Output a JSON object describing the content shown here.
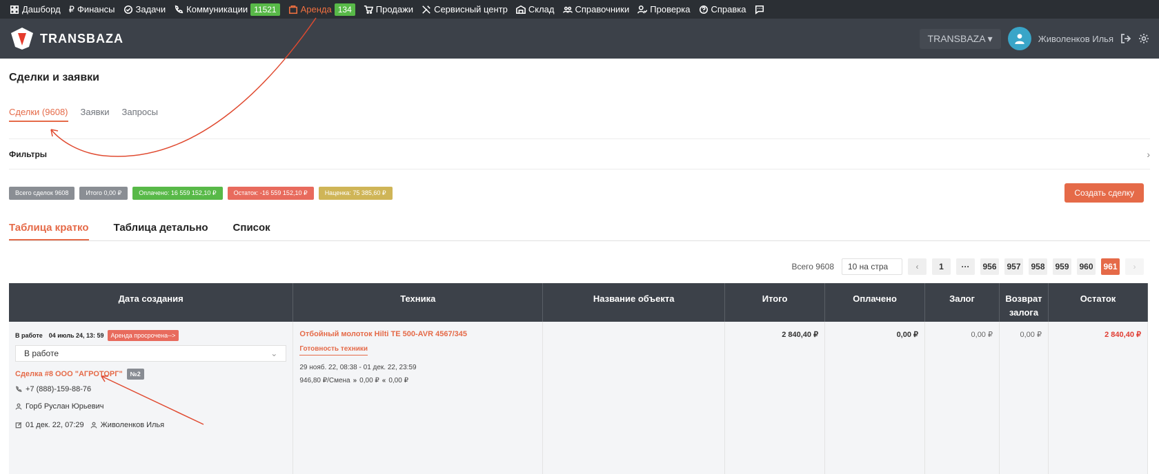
{
  "topnav": {
    "items": [
      {
        "label": "Дашборд",
        "icon": "dashboard-icon"
      },
      {
        "label": "Финансы",
        "icon": "ruble-icon"
      },
      {
        "label": "Задачи",
        "icon": "check-circle-icon"
      },
      {
        "label": "Коммуникации",
        "icon": "phone-icon",
        "badge": "11521"
      },
      {
        "label": "Аренда",
        "icon": "rent-icon",
        "badge": "134",
        "active": true
      },
      {
        "label": "Продажи",
        "icon": "cart-icon"
      },
      {
        "label": "Сервисный центр",
        "icon": "tools-icon"
      },
      {
        "label": "Склад",
        "icon": "warehouse-icon"
      },
      {
        "label": "Справочники",
        "icon": "users-icon"
      },
      {
        "label": "Проверка",
        "icon": "user-check-icon"
      },
      {
        "label": "Справка",
        "icon": "help-icon"
      }
    ]
  },
  "header": {
    "logo_text": "TRANSBAZA",
    "company": "TRANSBAZA",
    "user_name": "Живоленков Илья"
  },
  "page": {
    "title": "Сделки и заявки",
    "tabs": [
      "Сделки (9608)",
      "Заявки",
      "Запросы"
    ],
    "filters_label": "Фильтры"
  },
  "stats": [
    {
      "text": "Всего сделок 9608",
      "color": "#8a8e94"
    },
    {
      "text": "Итого 0,00 ₽",
      "color": "#8a8e94"
    },
    {
      "text": "Оплачено: 16 559 152,10 ₽",
      "color": "#58b948"
    },
    {
      "text": "Остаток: -16 559 152,10 ₽",
      "color": "#e86b5d"
    },
    {
      "text": "Наценка: 75 385,60 ₽",
      "color": "#cfb557"
    }
  ],
  "create_button": "Создать сделку",
  "view_tabs": [
    "Таблица кратко",
    "Таблица детально",
    "Список"
  ],
  "pagination": {
    "total": "Всего 9608",
    "per_page": "10 на стра",
    "pages": [
      "1",
      "···",
      "956",
      "957",
      "958",
      "959",
      "960",
      "961"
    ],
    "current": "961"
  },
  "table": {
    "headers": [
      "Дата создания",
      "Техника",
      "Название объекта",
      "Итого",
      "Оплачено",
      "Залог",
      "Возврат залога",
      "Остаток"
    ],
    "row": {
      "status": "В работе",
      "date": "04 июль 24, 13: 59",
      "overdue": "Аренда просрочена-->",
      "status_select": "В работе",
      "deal": "Сделка #8 ООО \"АГРОТОРГ\"",
      "deal_num": "№2",
      "phone": "+7 (888)-159-88-76",
      "contact": "Горб Руслан Юрьевич",
      "edited": "01 дек. 22, 07:29",
      "manager": "Живоленков Илья",
      "tech": "Отбойный молоток Hilti TE 500-AVR 4567/345",
      "ready": "Готовность техники",
      "period": "29 нояб. 22, 08:38 - 01 дек. 22, 23:59",
      "rate": "946,80 ₽/Смена",
      "rate_in": "0,00 ₽",
      "rate_out": "0,00 ₽",
      "object": "",
      "total": "2 840,40 ₽",
      "paid": "0,00 ₽",
      "deposit": "0,00 ₽",
      "deposit_return": "0,00 ₽",
      "balance": "2 840,40 ₽"
    }
  },
  "colors": {
    "accent": "#e56a48",
    "nav_bg": "#2b2f34",
    "header_bg": "#3c4149"
  }
}
